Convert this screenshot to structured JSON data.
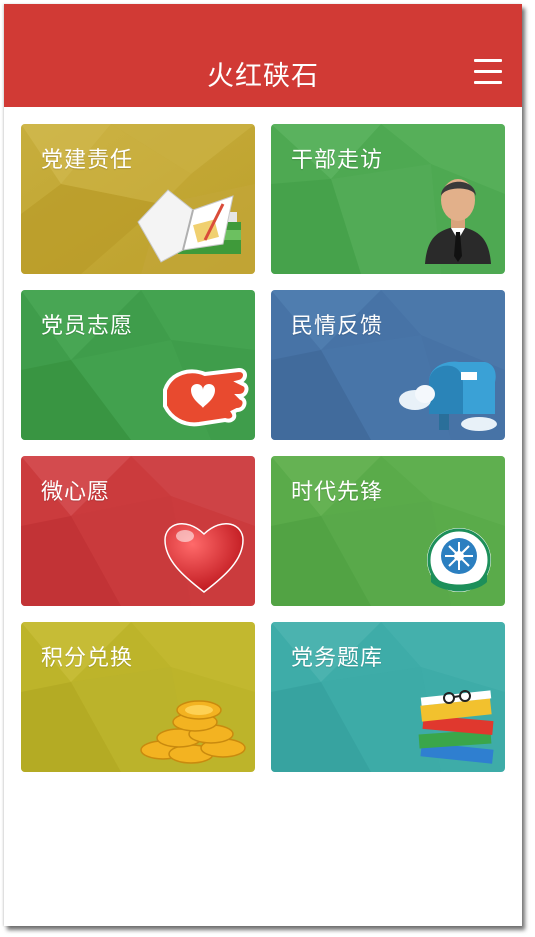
{
  "header": {
    "title": "火红硖石",
    "menu_icon": "hamburger-menu-icon",
    "background_color": "#d13a35"
  },
  "tiles": [
    {
      "label": "党建责任",
      "icon": "open-book-icon",
      "color": "#c4a934"
    },
    {
      "label": "干部走访",
      "icon": "officer-avatar-icon",
      "color": "#4fab52"
    },
    {
      "label": "党员志愿",
      "icon": "helping-hand-heart-icon",
      "color": "#3d9c4a"
    },
    {
      "label": "民情反馈",
      "icon": "mailbox-icon",
      "color": "#4675a8"
    },
    {
      "label": "微心愿",
      "icon": "red-heart-icon",
      "color": "#cc3d3f"
    },
    {
      "label": "时代先锋",
      "icon": "cadre-education-logo-icon",
      "color": "#5cac48"
    },
    {
      "label": "积分兑换",
      "icon": "gold-coins-icon",
      "color": "#bfb52a"
    },
    {
      "label": "党务题库",
      "icon": "stacked-books-icon",
      "color": "#3faea8"
    }
  ]
}
